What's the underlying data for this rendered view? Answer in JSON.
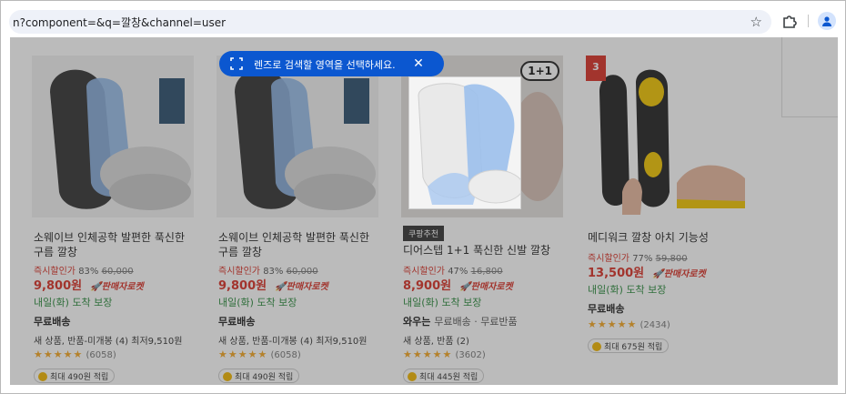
{
  "browser": {
    "url": "n?component=&q=깔창&channel=user",
    "bookmark_icon": "star-icon",
    "extension_icon": "puzzle-icon",
    "profile_icon": "person-icon"
  },
  "lens": {
    "prompt": "렌즈로 검색할 영역을 선택하세요.",
    "close_label": "✕",
    "color": "#0b57d0"
  },
  "products": [
    {
      "rank": "",
      "title": "소웨이브 인체공학 발편한 푹신한 구름 깔창",
      "discount_label": "즉시할인가",
      "discount_rate": "83%",
      "original_price": "60,000",
      "price": "9,800원",
      "rocket": "판매자로켓",
      "delivery": "내일(화) 도착 보장",
      "shipping": "무료배송",
      "shipping_extra": "",
      "options": "새 상품, 반품-미개봉 (4) 최저9,510원",
      "stars": "★★★★★",
      "review_count": "(6058)",
      "points": "최대 490원 적립"
    },
    {
      "rank": "",
      "title": "소웨이브 인체공학 발편한 푹신한 구름 깔창",
      "discount_label": "즉시할인가",
      "discount_rate": "83%",
      "original_price": "60,000",
      "price": "9,800원",
      "rocket": "판매자로켓",
      "delivery": "내일(화) 도착 보장",
      "shipping": "무료배송",
      "shipping_extra": "",
      "options": "새 상품, 반품-미개봉 (4) 최저9,510원",
      "stars": "★★★★★",
      "review_count": "(6058)",
      "points": "최대 490원 적립"
    },
    {
      "rank": "",
      "tag": "쿠팡추천",
      "badge": "1+1",
      "title": "디어스텝 1+1 푹신한 신발 깔창",
      "discount_label": "즉시할인가",
      "discount_rate": "47%",
      "original_price": "16,800",
      "price": "8,900원",
      "rocket": "판매자로켓",
      "delivery": "내일(화) 도착 보장",
      "shipping": "와우는",
      "shipping_extra": "무료배송 · 무료반품",
      "options": "새 상품, 반품 (2)",
      "stars": "★★★★★",
      "review_count": "(3602)",
      "points": "최대 445원 적립"
    },
    {
      "rank": "3",
      "title": "메디워크 깔창 아치 기능성",
      "discount_label": "즉시할인가",
      "discount_rate": "77%",
      "original_price": "59,800",
      "price": "13,500원",
      "rocket": "판매자로켓",
      "delivery": "내일(화) 도착 보장",
      "shipping": "무료배송",
      "shipping_extra": "",
      "options": "",
      "stars": "★★★★★",
      "review_count": "(2434)",
      "points": "최대 675원 적립"
    }
  ]
}
